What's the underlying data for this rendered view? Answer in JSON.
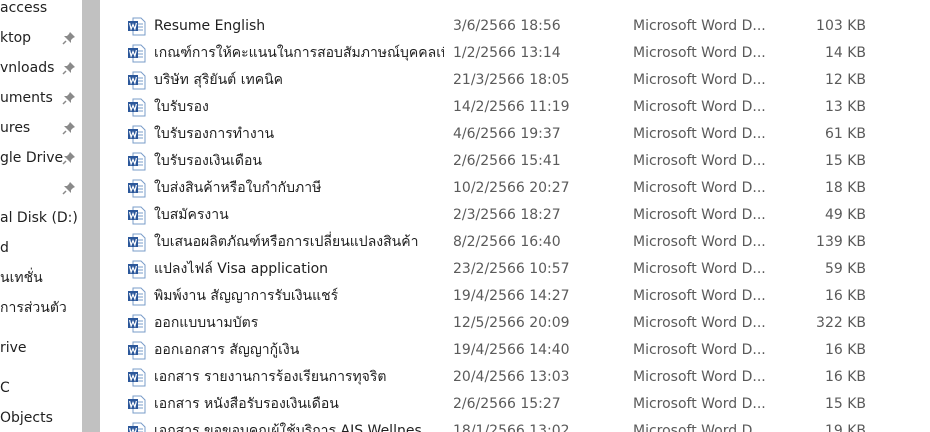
{
  "nav": {
    "items": [
      {
        "label": "access",
        "pinned": false
      },
      {
        "label": "ktop",
        "pinned": true
      },
      {
        "label": "vnloads",
        "pinned": true
      },
      {
        "label": "uments",
        "pinned": true
      },
      {
        "label": "ures",
        "pinned": true
      },
      {
        "label": "gle Drive",
        "pinned": true
      },
      {
        "label": "",
        "pinned": true
      },
      {
        "label": "al Disk (D:)",
        "pinned": false
      },
      {
        "label": "d",
        "pinned": false
      },
      {
        "label": "ันเทชั่น",
        "pinned": false
      },
      {
        "label": "การส่วนตัว",
        "pinned": false
      },
      {
        "label": "rive",
        "pinned": false
      },
      {
        "label": "C",
        "pinned": false
      },
      {
        "label": "Objects",
        "pinned": false
      }
    ]
  },
  "files": [
    {
      "name": "Resume English",
      "date": "3/6/2566 18:56",
      "type": "Microsoft Word D...",
      "size": "103 KB"
    },
    {
      "name": "เกณฑ์การให้คะแนนในการสอบสัมภาษณ์บุคคลเพื่...",
      "date": "1/2/2566 13:14",
      "type": "Microsoft Word D...",
      "size": "14 KB"
    },
    {
      "name": "บริษัท สุริยันต์ เทคนิค",
      "date": "21/3/2566 18:05",
      "type": "Microsoft Word D...",
      "size": "12 KB"
    },
    {
      "name": "ใบรับรอง",
      "date": "14/2/2566 11:19",
      "type": "Microsoft Word D...",
      "size": "13 KB"
    },
    {
      "name": "ใบรับรองการทำงาน",
      "date": "4/6/2566 19:37",
      "type": "Microsoft Word D...",
      "size": "61 KB"
    },
    {
      "name": "ใบรับรองเงินเดือน",
      "date": "2/6/2566 15:41",
      "type": "Microsoft Word D...",
      "size": "15 KB"
    },
    {
      "name": "ใบส่งสินค้าหรือใบกำกับภาษี",
      "date": "10/2/2566 20:27",
      "type": "Microsoft Word D...",
      "size": "18 KB"
    },
    {
      "name": "ใบสมัครงาน",
      "date": "2/3/2566 18:27",
      "type": "Microsoft Word D...",
      "size": "49 KB"
    },
    {
      "name": "ใบเสนอผลิตภัณฑ์หรือการเปลี่ยนแปลงสินค้า",
      "date": "8/2/2566 16:40",
      "type": "Microsoft Word D...",
      "size": "139 KB"
    },
    {
      "name": "แปลงไฟล์ Visa application",
      "date": "23/2/2566 10:57",
      "type": "Microsoft Word D...",
      "size": "59 KB"
    },
    {
      "name": "พิมพ์งาน สัญญาการรับเงินแชร์",
      "date": "19/4/2566 14:27",
      "type": "Microsoft Word D...",
      "size": "16 KB"
    },
    {
      "name": "ออกแบบนามบัตร",
      "date": "12/5/2566 20:09",
      "type": "Microsoft Word D...",
      "size": "322 KB"
    },
    {
      "name": "ออกเอกสาร สัญญากู้เงิน",
      "date": "19/4/2566 14:40",
      "type": "Microsoft Word D...",
      "size": "16 KB"
    },
    {
      "name": "เอกสาร รายงานการร้องเรียนการทุจริต",
      "date": "20/4/2566 13:03",
      "type": "Microsoft Word D...",
      "size": "16 KB"
    },
    {
      "name": "เอกสาร หนังสือรับรองเงินเดือน",
      "date": "2/6/2566 15:27",
      "type": "Microsoft Word D...",
      "size": "15 KB"
    },
    {
      "name": "เอกสาร ขอขอบคุณผู้ใช้บริการ AIS Wellnes",
      "date": "18/1/2566 13:02",
      "type": "Microsoft Word D...",
      "size": "19 KB"
    }
  ],
  "icons": {
    "word": "word-doc-icon",
    "pin": "pin-icon"
  },
  "colors": {
    "word_blue": "#2b579a",
    "secondary_text": "#5a5a5a"
  }
}
